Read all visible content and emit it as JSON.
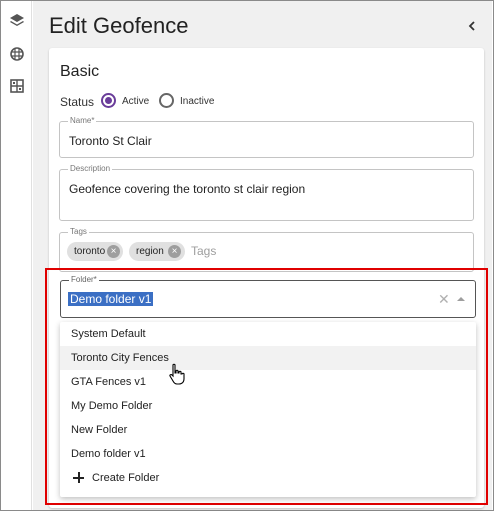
{
  "rail": {
    "icons": [
      "layers-icon",
      "globe-grid-icon",
      "grid-box-icon"
    ]
  },
  "header": {
    "title": "Edit Geofence"
  },
  "basic": {
    "title": "Basic",
    "status_label": "Status",
    "status_options": [
      "Active",
      "Inactive"
    ],
    "status_selected": "Active",
    "name": {
      "label": "Name*",
      "value": "Toronto St Clair"
    },
    "description": {
      "label": "Description",
      "value": "Geofence covering the toronto st clair region"
    },
    "tags": {
      "label": "Tags",
      "chips": [
        "toronto",
        "region"
      ],
      "placeholder": "Tags"
    },
    "folder": {
      "label": "Folder*",
      "value": "Demo folder v1",
      "options": [
        "System Default",
        "Toronto City Fences",
        "GTA Fences v1",
        "My Demo Folder",
        "New Folder",
        "Demo folder v1"
      ],
      "hovered_option": "Toronto City Fences",
      "create_label": "Create Folder"
    }
  },
  "colors": {
    "accent": "#6a3d9a",
    "highlight_border": "#e00000",
    "selection": "#3b6fc4"
  }
}
